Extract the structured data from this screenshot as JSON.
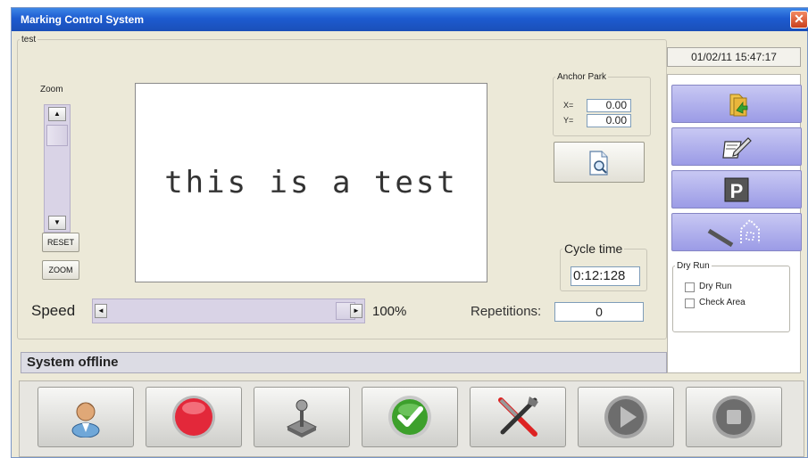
{
  "window": {
    "title": "Marking Control System",
    "close_icon": "close-icon"
  },
  "preview_group": {
    "title": "test",
    "preview_text": "this is a test"
  },
  "zoom": {
    "label": "Zoom",
    "reset_label": "RESET",
    "zoom_label": "ZOOM"
  },
  "anchor": {
    "title": "Anchor Park",
    "x_label": "X=",
    "y_label": "Y=",
    "x_value": "0.00",
    "y_value": "0.00"
  },
  "cycle": {
    "title": "Cycle time",
    "value": "0:12:128"
  },
  "speed": {
    "label": "Speed",
    "value": "100%",
    "level_fraction": 1.0
  },
  "repetitions": {
    "label": "Repetitions:",
    "value": "0"
  },
  "datetime": "01/02/11 15:47:17",
  "side_buttons": [
    {
      "icon": "open-file-icon"
    },
    {
      "icon": "edit-icon"
    },
    {
      "icon": "park-icon",
      "glyph": "P"
    },
    {
      "icon": "marking-area-icon"
    }
  ],
  "dry_run": {
    "title": "Dry Run",
    "dry_run_label": "Dry Run",
    "check_area_label": "Check Area"
  },
  "status": "System offline",
  "toolbar_icons": [
    "user-icon",
    "stop-icon",
    "joystick-icon",
    "check-icon",
    "tools-icon",
    "play-icon",
    "pause-icon"
  ],
  "colors": {
    "title_bar": "#1d5bd0",
    "side_button": "#9b9be6",
    "stop_red": "#e3283a",
    "check_green": "#3da02c"
  }
}
